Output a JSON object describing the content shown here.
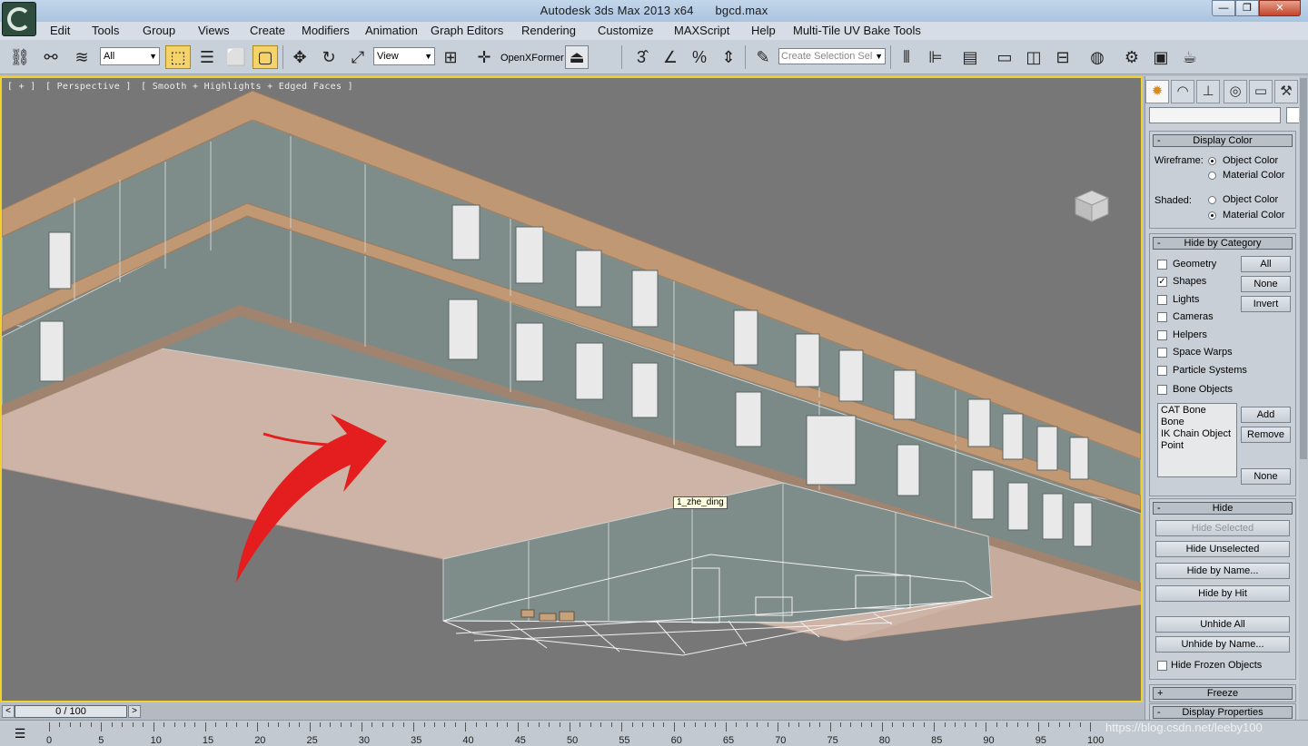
{
  "title_bar": {
    "app_name": "Autodesk 3ds Max  2013 x64",
    "file_name": "bgcd.max",
    "minimize": "—",
    "maximize": "❐",
    "close": "✕"
  },
  "menu": [
    "Edit",
    "Tools",
    "Group",
    "Views",
    "Create",
    "Modifiers",
    "Animation",
    "Graph Editors",
    "Rendering",
    "Customize",
    "MAXScript",
    "Help",
    "Multi-Tile UV Bake Tools"
  ],
  "toolbar": {
    "filter_dropdown": "All",
    "refcoord_dropdown": "View",
    "openx_label": "OpenXFormer",
    "selection_set_placeholder": "Create Selection Sel"
  },
  "viewport": {
    "label_parts": [
      "[ + ]",
      "[ Perspective ]",
      "[ Smooth + Highlights + Edged Faces ]"
    ],
    "tooltip": "1_zhe_ding",
    "viewcube_label": "LEFT  FRONT"
  },
  "command_panel": {
    "tabs": [
      "create-icon",
      "modify-icon",
      "hierarchy-icon",
      "motion-icon",
      "display-icon",
      "utilities-icon"
    ],
    "display_color": {
      "title": "Display Color",
      "wireframe_label": "Wireframe:",
      "shaded_label": "Shaded:",
      "object_color": "Object Color",
      "material_color": "Material Color"
    },
    "hide_by_category": {
      "title": "Hide by Category",
      "items": [
        {
          "label": "Geometry",
          "checked": false
        },
        {
          "label": "Shapes",
          "checked": true
        },
        {
          "label": "Lights",
          "checked": false
        },
        {
          "label": "Cameras",
          "checked": false
        },
        {
          "label": "Helpers",
          "checked": false
        },
        {
          "label": "Space Warps",
          "checked": false
        },
        {
          "label": "Particle Systems",
          "checked": false
        },
        {
          "label": "Bone Objects",
          "checked": false
        }
      ],
      "all_btn": "All",
      "none_btn": "None",
      "invert_btn": "Invert",
      "list": [
        "CAT Bone",
        "Bone",
        "IK Chain Object",
        "Point"
      ],
      "add_btn": "Add",
      "remove_btn": "Remove",
      "none_btn2": "None"
    },
    "hide": {
      "title": "Hide",
      "hide_selected": "Hide Selected",
      "hide_unselected": "Hide Unselected",
      "hide_by_name": "Hide by Name...",
      "hide_by_hit": "Hide by Hit",
      "unhide_all": "Unhide All",
      "unhide_by_name": "Unhide by Name...",
      "hide_frozen": "Hide Frozen Objects"
    },
    "freeze": {
      "title": "Freeze"
    },
    "display_properties": {
      "title": "Display Properties"
    },
    "minus": "-",
    "plus": "+"
  },
  "timeline": {
    "frame_display": "0 / 100",
    "ticks": [
      "0",
      "5",
      "10",
      "15",
      "20",
      "25",
      "30",
      "35",
      "40",
      "45",
      "50",
      "55",
      "60",
      "65",
      "70",
      "75",
      "80",
      "85",
      "90",
      "95",
      "100"
    ]
  },
  "watermark": "https://blog.csdn.net/leeby100",
  "colors": {
    "viewport_bg": "#777777",
    "viewport_border": "#f2d12a",
    "facade": "#7e8c8a",
    "trim": "#c09874",
    "soffit": "#cdb4a6",
    "arrow": "#e41e1e"
  }
}
